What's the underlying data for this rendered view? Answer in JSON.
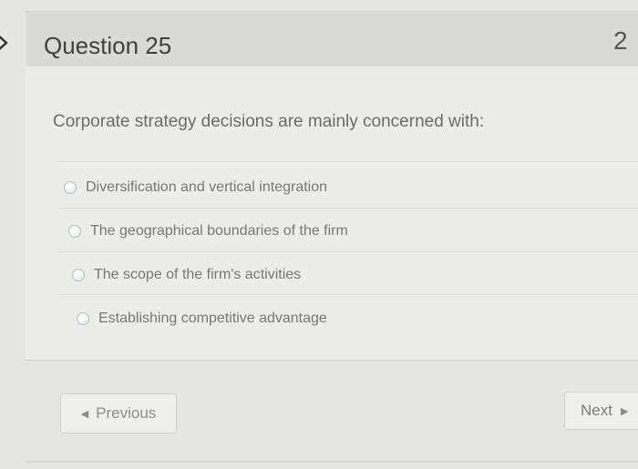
{
  "question": {
    "title": "Question 25",
    "points": "2",
    "prompt": "Corporate strategy decisions are mainly concerned with:"
  },
  "options": [
    {
      "label": "Diversification and vertical integration",
      "selected": false
    },
    {
      "label": "The geographical boundaries of the firm",
      "selected": false
    },
    {
      "label": "The scope of the firm's activities",
      "selected": false
    },
    {
      "label": "Establishing competitive advantage",
      "selected": false
    }
  ],
  "navigation": {
    "previous_label": "Previous",
    "next_label": "Next"
  },
  "icons": {
    "side": "chevron-right-icon",
    "previous": "triangle-left-icon",
    "next": "triangle-right-icon"
  }
}
